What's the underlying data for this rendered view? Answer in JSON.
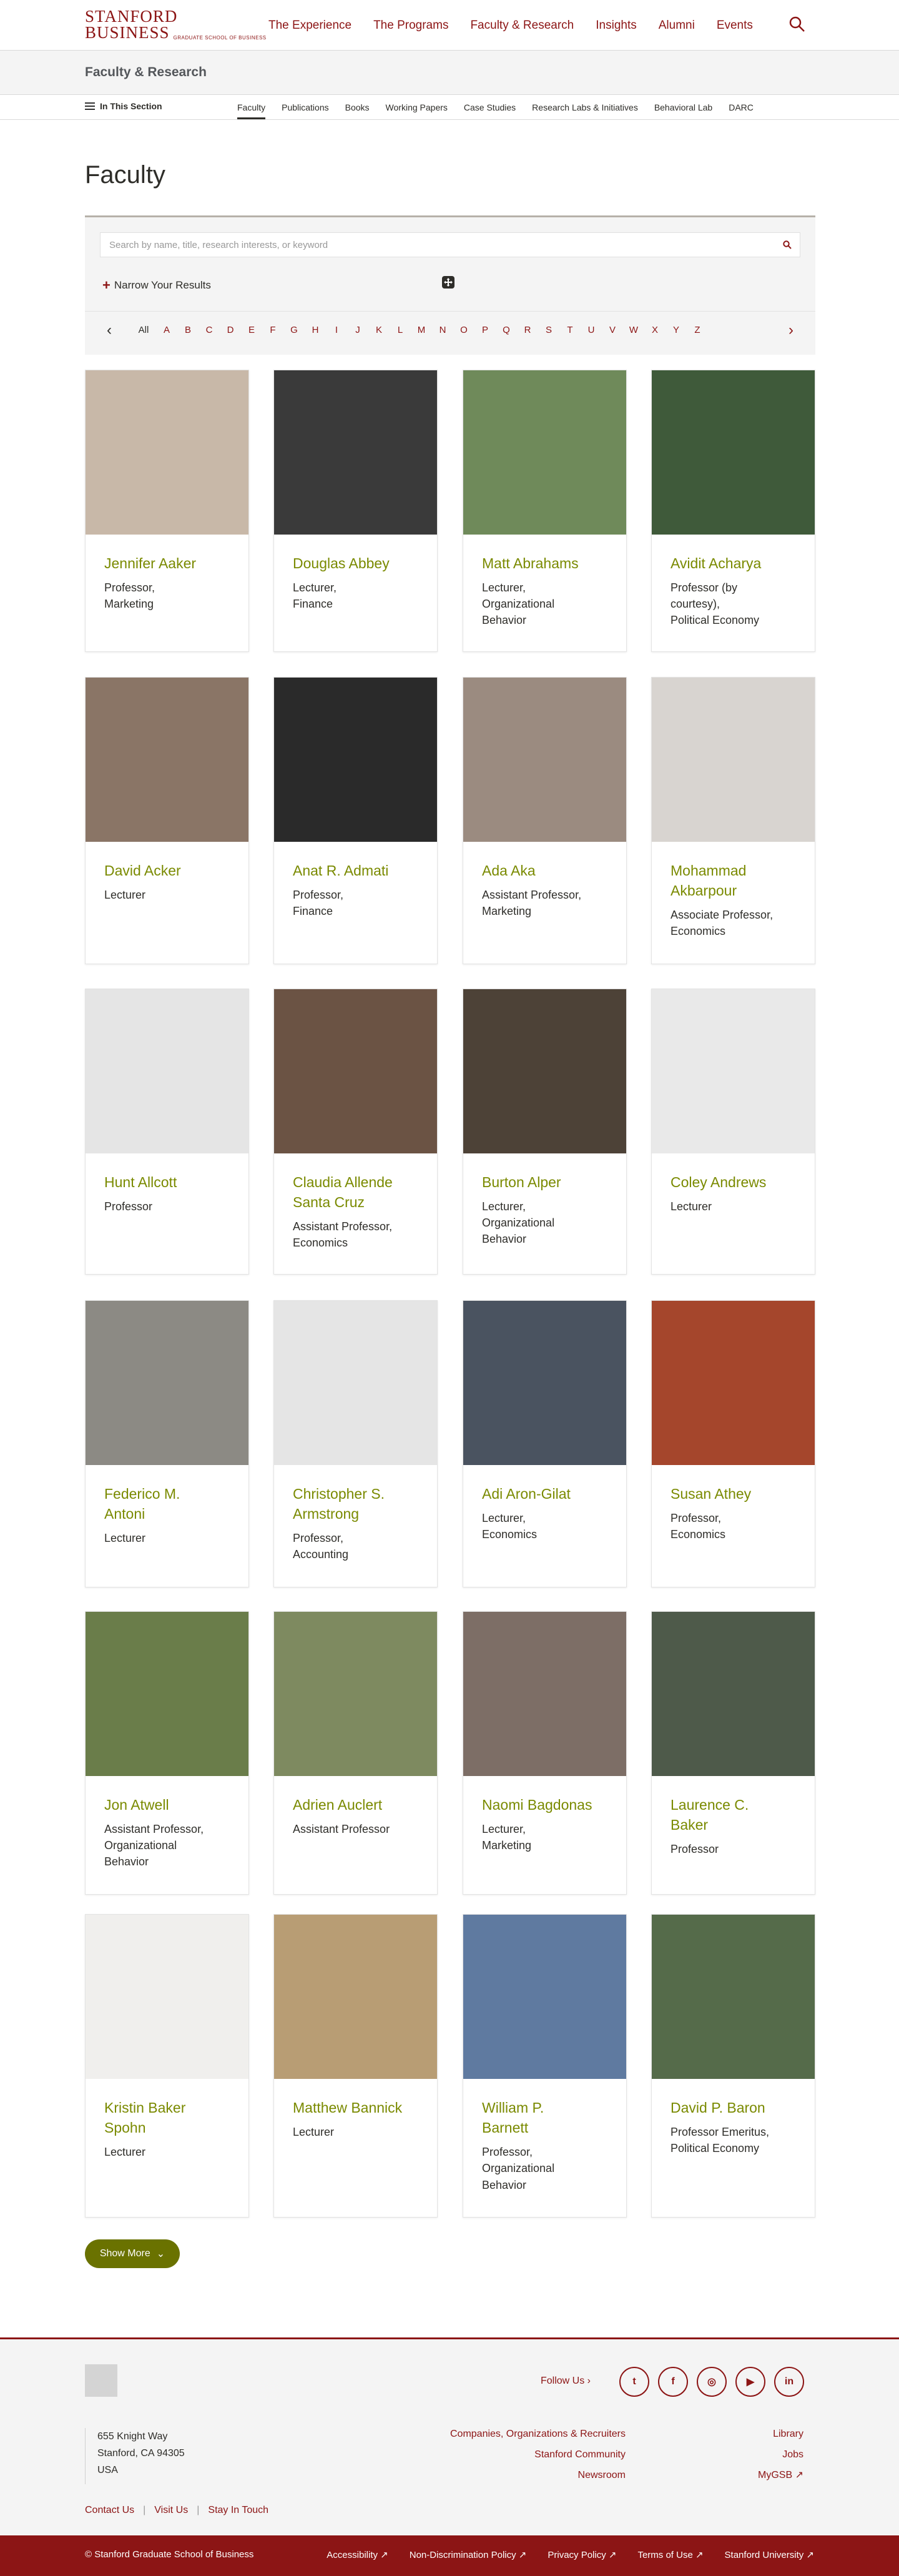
{
  "header": {
    "logo_line1": "STANFORD",
    "logo_line2": "BUSINESS",
    "logo_small": "GRADUATE SCHOOL OF BUSINESS",
    "nav": [
      "The Experience",
      "The Programs",
      "Faculty & Research",
      "Insights",
      "Alumni",
      "Events"
    ],
    "search_icon": "search-icon"
  },
  "section": {
    "title": "Faculty & Research"
  },
  "subnav": {
    "in_section": "In This Section",
    "tabs": [
      "Faculty",
      "Publications",
      "Books",
      "Working Papers",
      "Case Studies",
      "Research Labs & Initiatives",
      "Behavioral Lab",
      "DARC"
    ],
    "active": "Faculty"
  },
  "page_title": "Faculty",
  "filter": {
    "placeholder": "Search by name, title, research interests, or keyword",
    "narrow": "Narrow Your Results",
    "letters_all": "All",
    "letters": [
      "A",
      "B",
      "C",
      "D",
      "E",
      "F",
      "G",
      "H",
      "I",
      "J",
      "K",
      "L",
      "M",
      "N",
      "O",
      "P",
      "Q",
      "R",
      "S",
      "T",
      "U",
      "V",
      "W",
      "X",
      "Y",
      "Z"
    ]
  },
  "faculty": [
    {
      "name": "Jennifer Aaker",
      "title": "Professor,\nMarketing",
      "photo": "#c8b8a8"
    },
    {
      "name": "Douglas Abbey",
      "title": "Lecturer,\nFinance",
      "photo": "#3a3a3a"
    },
    {
      "name": "Matt Abrahams",
      "title": "Lecturer,\nOrganizational\nBehavior",
      "photo": "#6f8a5a"
    },
    {
      "name": "Avidit Acharya",
      "title": "Professor (by\ncourtesy),\nPolitical Economy",
      "photo": "#3f5a3a"
    },
    {
      "name": "David Acker",
      "title": "Lecturer",
      "photo": "#8a7566"
    },
    {
      "name": "Anat R. Admati",
      "title": "Professor,\nFinance",
      "photo": "#2a2a2a"
    },
    {
      "name": "Ada Aka",
      "title": "Assistant Professor,\nMarketing",
      "photo": "#9b8b80"
    },
    {
      "name": "Mohammad\nAkbarpour",
      "title": "Associate Professor,\nEconomics",
      "photo": "#d8d4d0"
    },
    {
      "name": "Hunt Allcott",
      "title": "Professor",
      "photo": "#e5e5e5"
    },
    {
      "name": "Claudia Allende\nSanta Cruz",
      "title": "Assistant Professor,\nEconomics",
      "photo": "#6b5344"
    },
    {
      "name": "Burton Alper",
      "title": "Lecturer,\nOrganizational\nBehavior",
      "photo": "#4d4237"
    },
    {
      "name": "Coley Andrews",
      "title": "Lecturer",
      "photo": "#e9e9e9"
    },
    {
      "name": "Federico M.\nAntoni",
      "title": "Lecturer",
      "photo": "#8c8a84"
    },
    {
      "name": "Christopher S.\nArmstrong",
      "title": "Professor,\nAccounting",
      "photo": "#e5e5e5"
    },
    {
      "name": "Adi Aron-Gilat",
      "title": "Lecturer,\nEconomics",
      "photo": "#4a5360"
    },
    {
      "name": "Susan Athey",
      "title": "Professor,\nEconomics",
      "photo": "#a5462c"
    },
    {
      "name": "Jon Atwell",
      "title": "Assistant Professor,\nOrganizational\nBehavior",
      "photo": "#6a7d4a"
    },
    {
      "name": "Adrien Auclert",
      "title": "Assistant Professor",
      "photo": "#7e8a60"
    },
    {
      "name": "Naomi Bagdonas",
      "title": "Lecturer,\nMarketing",
      "photo": "#7d6e66"
    },
    {
      "name": "Laurence C.\nBaker",
      "title": "Professor",
      "photo": "#4e5a4a"
    },
    {
      "name": "Kristin Baker\nSpohn",
      "title": "Lecturer",
      "photo": "#f0efed"
    },
    {
      "name": "Matthew Bannick",
      "title": "Lecturer",
      "photo": "#b89d74"
    },
    {
      "name": "William P.\nBarnett",
      "title": "Professor,\nOrganizational\nBehavior",
      "photo": "#5f7aa0"
    },
    {
      "name": "David P. Baron",
      "title": "Professor Emeritus,\nPolitical Economy",
      "photo": "#556b4a"
    }
  ],
  "show_more": "Show More",
  "footer": {
    "follow": "Follow Us",
    "social": [
      "twitter-icon",
      "facebook-icon",
      "instagram-icon",
      "youtube-icon",
      "linkedin-icon"
    ],
    "social_glyphs": [
      "t",
      "f",
      "◎",
      "▶",
      "in"
    ],
    "address": [
      "655 Knight Way",
      "Stanford, CA 94305",
      "USA"
    ],
    "links": [
      "Contact Us",
      "Visit Us",
      "Stay In Touch"
    ],
    "mid_links": [
      "Companies, Organizations & Recruiters",
      "Stanford Community",
      "Newsroom"
    ],
    "right_links": [
      "Library",
      "Jobs",
      "MyGSB ↗"
    ],
    "copyright": "© Stanford Graduate School of Business",
    "bottom_links": [
      "Accessibility ↗",
      "Non-Discrimination Policy ↗",
      "Privacy Policy ↗",
      "Terms of Use ↗",
      "Stanford University ↗"
    ]
  },
  "colors": {
    "brand": "#8c1515",
    "name_green": "#7a8a00",
    "button_green": "#6a7200"
  }
}
